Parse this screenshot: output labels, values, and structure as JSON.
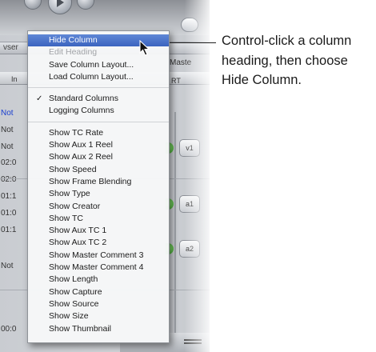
{
  "app": {
    "tab_strip_text": "vser",
    "master_tab_text": "Maste",
    "column_in_label": "In",
    "column_rt_label": "RT",
    "rows": [
      {
        "text": "Not",
        "blue": true
      },
      {
        "text": "Not",
        "blue": false
      },
      {
        "text": "Not",
        "blue": false
      },
      {
        "text": "02:0",
        "blue": false
      },
      {
        "text": "02:0",
        "blue": false
      },
      {
        "text": "01:1",
        "blue": false
      },
      {
        "text": "01:0",
        "blue": false
      },
      {
        "text": "01:1",
        "blue": false
      },
      {
        "text": "Not",
        "blue": false
      },
      {
        "text": "00:0",
        "blue": false
      }
    ],
    "track_buttons": [
      "v1",
      "a1",
      "a2"
    ]
  },
  "menu": {
    "group1": [
      {
        "label": "Hide Column",
        "state": "highlight"
      },
      {
        "label": "Edit Heading",
        "state": "disabled"
      },
      {
        "label": "Save Column Layout...",
        "state": "normal"
      },
      {
        "label": "Load Column Layout...",
        "state": "normal"
      }
    ],
    "group2": [
      {
        "label": "Standard Columns",
        "checked": true
      },
      {
        "label": "Logging Columns",
        "checked": false
      }
    ],
    "group3": [
      "Show TC Rate",
      "Show Aux 1 Reel",
      "Show Aux 2 Reel",
      "Show Speed",
      "Show Frame Blending",
      "Show Type",
      "Show Creator",
      "Show TC",
      "Show Aux TC 1",
      "Show Aux TC 2",
      "Show Master Comment 3",
      "Show Master Comment 4",
      "Show Length",
      "Show Capture",
      "Show Source",
      "Show Size",
      "Show Thumbnail"
    ],
    "check_glyph": "✓"
  },
  "callout": {
    "text": "Control-click a column heading, then choose Hide Column."
  },
  "icons": {
    "pointer": "arrow-cursor-icon",
    "play": "play-icon",
    "grip": "resize-grip-icon"
  },
  "colors": {
    "highlight": "#3b64bf",
    "disabled_text": "#a2a4a8",
    "blue_row_text": "#1a3fd0"
  }
}
